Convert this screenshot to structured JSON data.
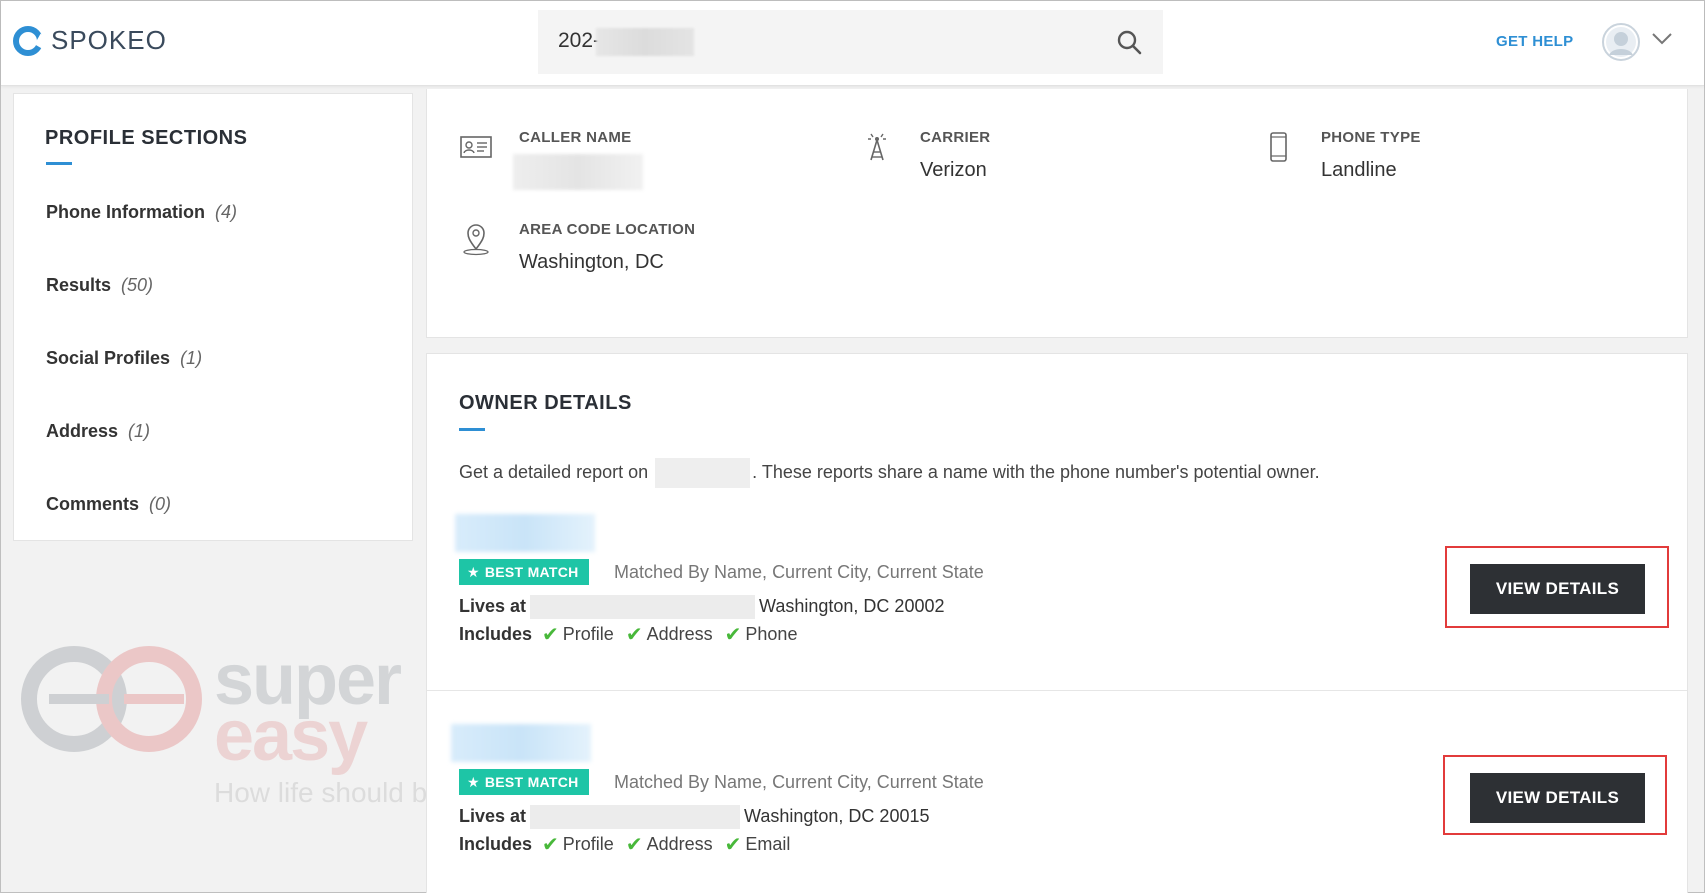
{
  "header": {
    "logo_text": "SPOKEO",
    "search_value": "202-",
    "get_help": "GET HELP"
  },
  "sidebar": {
    "title": "PROFILE SECTIONS",
    "items": [
      {
        "label": "Phone Information",
        "count": "(4)"
      },
      {
        "label": "Results",
        "count": "(50)"
      },
      {
        "label": "Social Profiles",
        "count": "(1)"
      },
      {
        "label": "Address",
        "count": "(1)"
      },
      {
        "label": "Comments",
        "count": "(0)"
      }
    ]
  },
  "phone_info": {
    "caller_name_label": "CALLER NAME",
    "carrier_label": "CARRIER",
    "carrier_value": "Verizon",
    "phone_type_label": "PHONE TYPE",
    "phone_type_value": "Landline",
    "area_code_label": "AREA CODE LOCATION",
    "area_code_value": "Washington, DC"
  },
  "owner_details": {
    "title": "OWNER DETAILS",
    "desc_prefix": "Get a detailed report on",
    "desc_suffix": ". These reports share a name with the phone number's potential owner.",
    "results": [
      {
        "badge": "BEST MATCH",
        "matched": "Matched By Name, Current City, Current State",
        "lives_label": "Lives at",
        "city": "Washington, DC 20002",
        "includes_label": "Includes",
        "includes": [
          "Profile",
          "Address",
          "Phone"
        ],
        "button": "VIEW DETAILS"
      },
      {
        "badge": "BEST MATCH",
        "matched": "Matched By Name, Current City, Current State",
        "lives_label": "Lives at",
        "city": "Washington, DC 20015",
        "includes_label": "Includes",
        "includes": [
          "Profile",
          "Address",
          "Email"
        ],
        "button": "VIEW DETAILS"
      }
    ]
  },
  "watermark": {
    "word1": "super",
    "word2": "easy",
    "tagline": "How life should be"
  },
  "colors": {
    "accent": "#2e8fd4",
    "badge": "#1ec5a6",
    "check": "#48b83a",
    "button": "#2d3034",
    "highlight": "#e23b3b"
  }
}
